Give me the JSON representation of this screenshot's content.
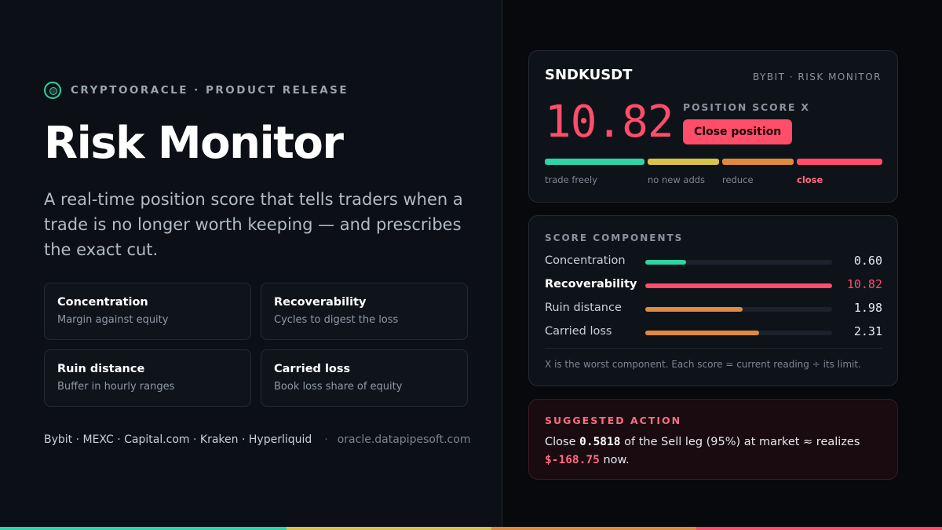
{
  "brand": {
    "eyebrow": "CRYPTOORACLE · PRODUCT RELEASE",
    "logo_icon": "ring-logo-icon"
  },
  "hero": {
    "title": "Risk Monitor",
    "subtitle": "A real-time position score that tells traders when a trade is no longer worth keeping — and prescribes the exact cut."
  },
  "features": [
    {
      "title": "Concentration",
      "desc": "Margin against equity"
    },
    {
      "title": "Recoverability",
      "desc": "Cycles to digest the loss"
    },
    {
      "title": "Ruin distance",
      "desc": "Buffer in hourly ranges"
    },
    {
      "title": "Carried loss",
      "desc": "Book loss share of equity"
    }
  ],
  "footer": {
    "exchanges": "Bybit · MEXC · Capital.com · Kraken · Hyperliquid",
    "separator": "·",
    "url": "oracle.datapipesoft.com"
  },
  "monitor": {
    "symbol": "SNDKUSDT",
    "venue": "BYBIT · RISK MONITOR",
    "score": "10.82",
    "score_label": "POSITION SCORE X",
    "close_button": "Close position",
    "zones": [
      {
        "label": "trade freely",
        "color": "#2ed3a7"
      },
      {
        "label": "no new adds",
        "color": "#d9c24a"
      },
      {
        "label": "reduce",
        "color": "#e08a3c"
      },
      {
        "label": "close",
        "color": "#ff4d6a"
      }
    ],
    "active_zone": "close"
  },
  "components": {
    "title": "SCORE COMPONENTS",
    "rows": [
      {
        "name": "Concentration",
        "value": "0.60",
        "fill": 0.22,
        "color": "#2ed3a7"
      },
      {
        "name": "Recoverability",
        "value": "10.82",
        "fill": 1.0,
        "color": "#ff4d6a"
      },
      {
        "name": "Ruin distance",
        "value": "1.98",
        "fill": 0.52,
        "color": "#e08a3c"
      },
      {
        "name": "Carried loss",
        "value": "2.31",
        "fill": 0.61,
        "color": "#e08a3c"
      }
    ],
    "footnote": "X is the worst component. Each score = current reading ÷ its limit."
  },
  "action": {
    "title": "SUGGESTED ACTION",
    "pre": "Close ",
    "qty": "0.5818",
    "mid": " of the Sell leg (95%) at market ≈ realizes",
    "pnl": "$-168.75",
    "post": " now."
  },
  "colors": {
    "accent_green": "#2ed3a7",
    "accent_yellow": "#d9c24a",
    "accent_orange": "#e08a3c",
    "accent_red": "#ff4d6a"
  }
}
